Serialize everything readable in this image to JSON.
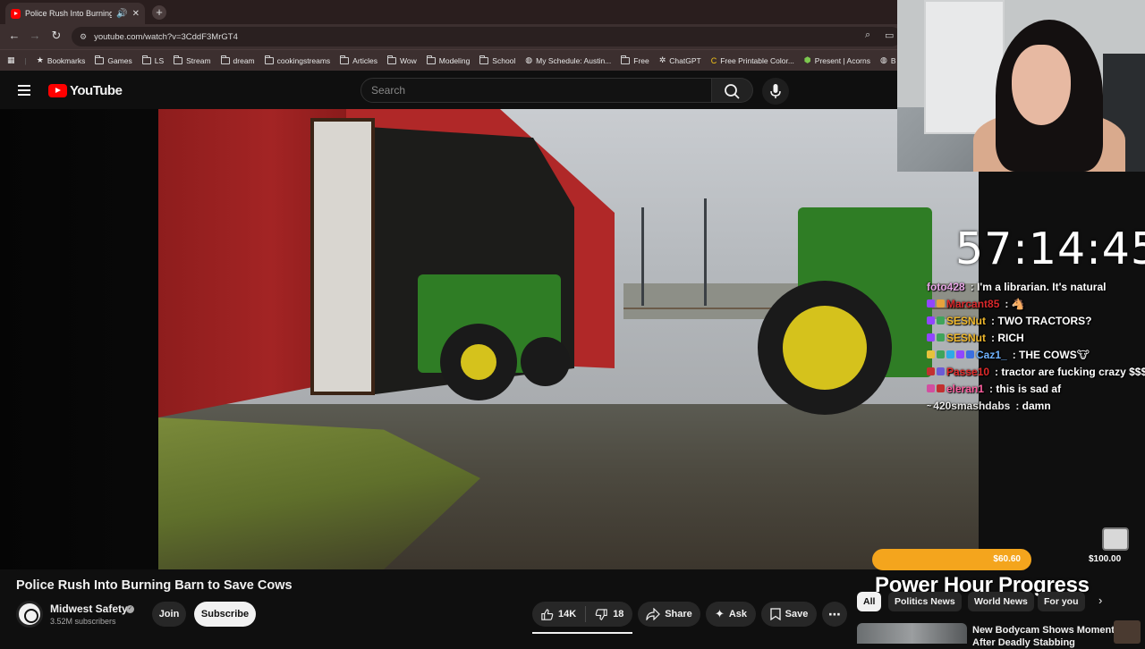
{
  "browser": {
    "tab_title": "Police Rush Into Burning Ba",
    "tab_audio_icon": "speaker-icon",
    "url": "youtube.com/watch?v=3CddF3MrGT4",
    "bookmarks": [
      {
        "label": "Bookmarks",
        "icon": "star-icon"
      },
      {
        "label": "Games",
        "icon": "folder-icon"
      },
      {
        "label": "LS",
        "icon": "folder-icon"
      },
      {
        "label": "Stream",
        "icon": "folder-icon"
      },
      {
        "label": "dream",
        "icon": "folder-icon"
      },
      {
        "label": "cookingstreams",
        "icon": "folder-icon"
      },
      {
        "label": "Articles",
        "icon": "folder-icon"
      },
      {
        "label": "Wow",
        "icon": "folder-icon"
      },
      {
        "label": "Modeling",
        "icon": "folder-icon"
      },
      {
        "label": "School",
        "icon": "folder-icon"
      },
      {
        "label": "My Schedule: Austin...",
        "icon": "globe-icon"
      },
      {
        "label": "Free",
        "icon": "folder-icon"
      },
      {
        "label": "ChatGPT",
        "icon": "chatgpt-icon"
      },
      {
        "label": "Free Printable Color...",
        "icon": "c-logo-icon"
      },
      {
        "label": "Present | Acorns",
        "icon": "acorn-icon"
      },
      {
        "label": "B",
        "icon": "globe-icon"
      }
    ]
  },
  "youtube": {
    "logo_text": "YouTube",
    "search_placeholder": "Search",
    "video_title": "Police Rush Into Burning Barn to Save Cows",
    "channel_name": "Midwest Safety",
    "subscribers": "3.52M subscribers",
    "join_label": "Join",
    "subscribe_label": "Subscribe",
    "likes": "14K",
    "dislikes": "18",
    "share_label": "Share",
    "ask_label": "Ask",
    "save_label": "Save",
    "chips": [
      "All",
      "Politics News",
      "World News",
      "For you"
    ],
    "recommended_title": "New Bodycam Shows Moments After Deadly Stabbing"
  },
  "overlay": {
    "timer": "57:14:45",
    "chat": [
      {
        "user": "foto428",
        "msg": "I'm a librarian. It's natural",
        "color": "#e7a6e6"
      },
      {
        "user": "Marcant85",
        "msg": "",
        "color": "#d8282b"
      },
      {
        "user": "SESNut",
        "msg": "TWO TRACTORS?",
        "color": "#f0b92d"
      },
      {
        "user": "SESNut",
        "msg": "RICH",
        "color": "#f0b92d"
      },
      {
        "user": "Caz1_",
        "msg": "THE COWS",
        "color": "#6fb2ff"
      },
      {
        "user": "Passe10",
        "msg": "tractor are fucking crazy $$$",
        "color": "#e02a2a"
      },
      {
        "user": "eleran1",
        "msg": "this is sad af",
        "color": "#ff5fa0"
      },
      {
        "user": "420smashdabs",
        "msg": "damn",
        "color": "#e8e8e8"
      }
    ],
    "progress_current": "$60.60",
    "progress_goal": "$100.00",
    "progress_fraction": 0.606,
    "progress_title": "Power Hour Progress"
  },
  "colors": {
    "youtube_red": "#ff0000",
    "progress_orange": "#f4a51d",
    "page_bg": "#0f0f0f"
  }
}
